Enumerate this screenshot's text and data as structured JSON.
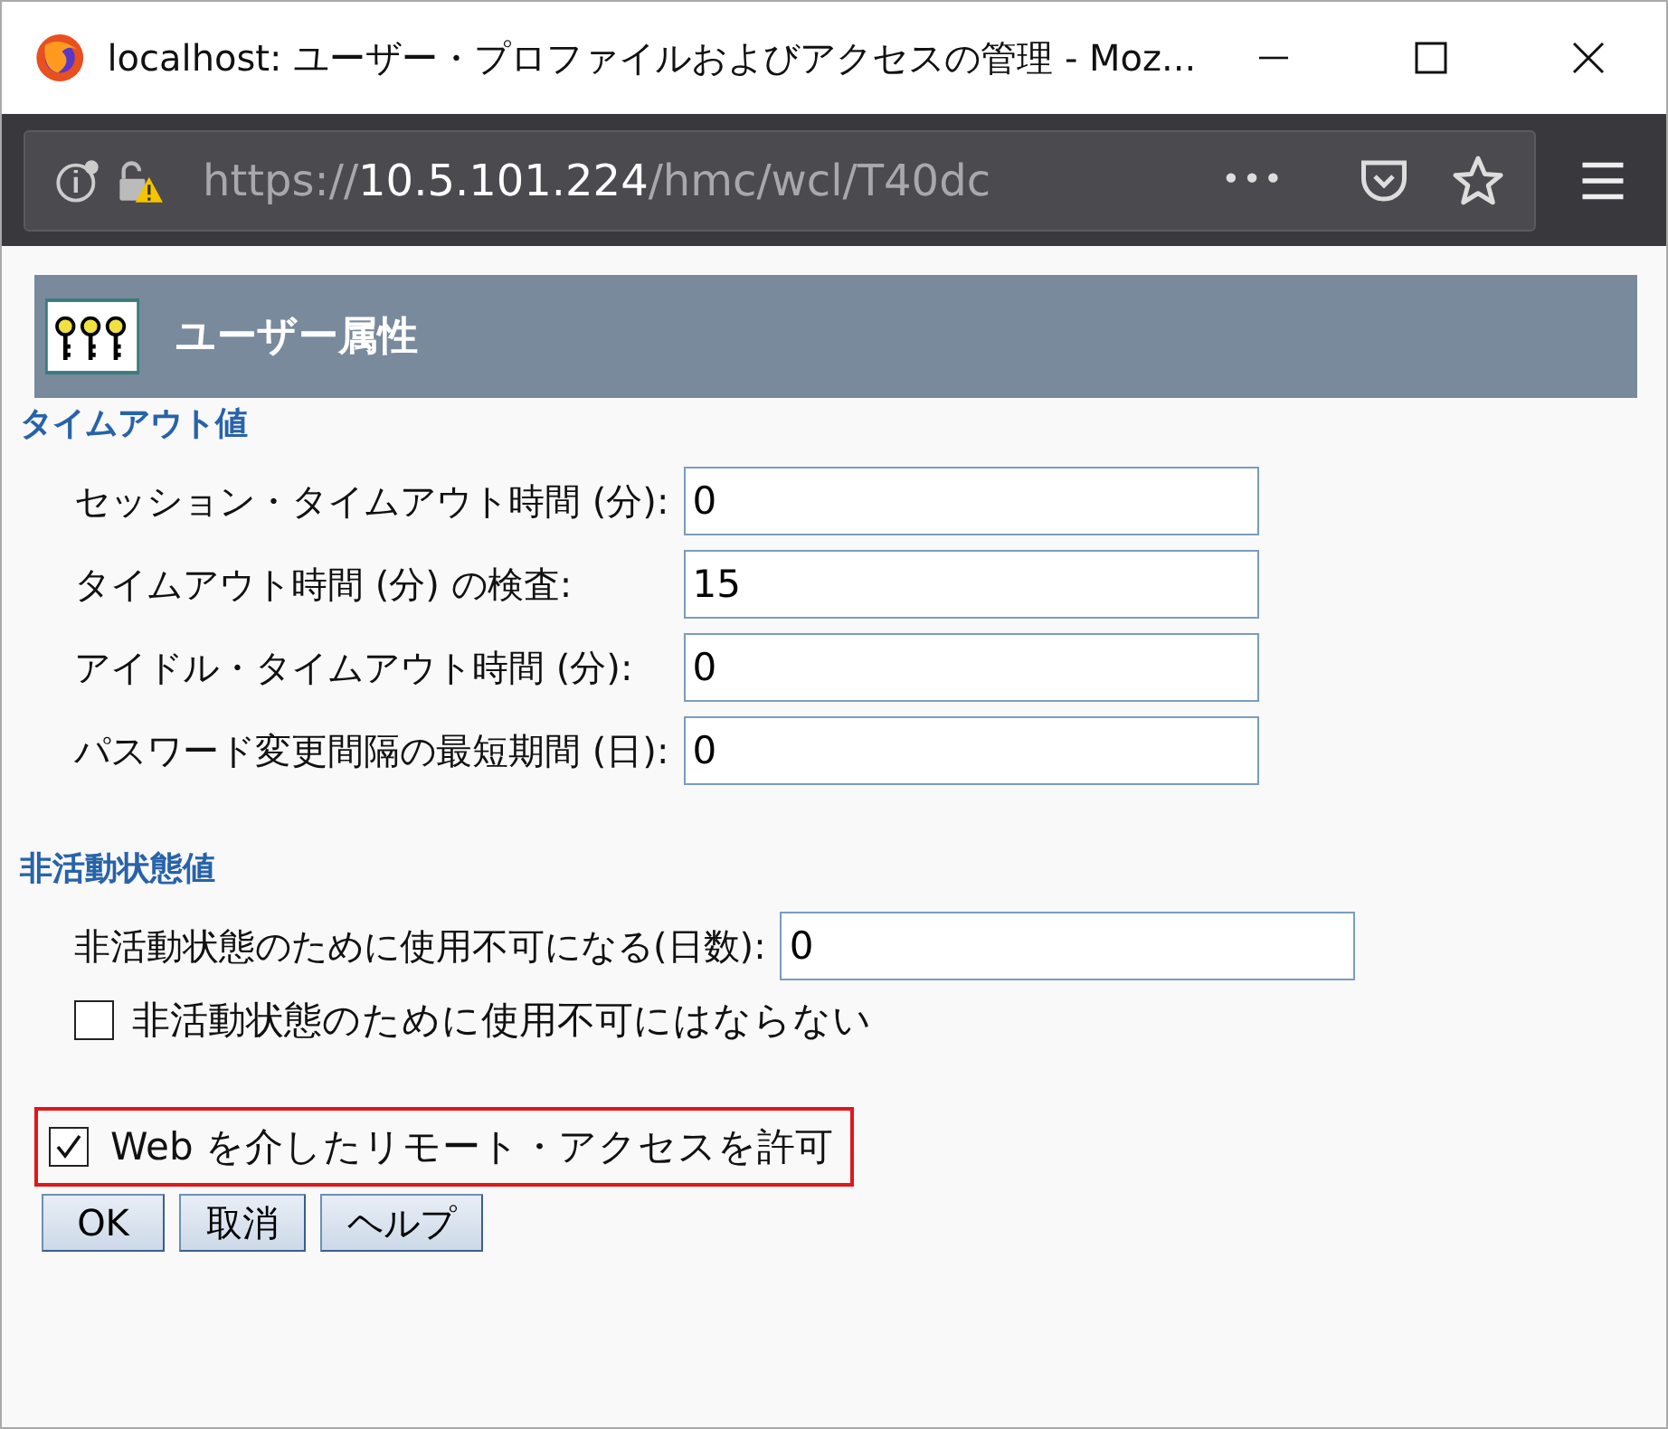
{
  "window": {
    "title": "localhost: ユーザー・プロファイルおよびアクセスの管理 - Moz..."
  },
  "url": {
    "scheme": "https://",
    "host": "10.5.101.224",
    "path": "/hmc/wcl/T40dc"
  },
  "toolbar": {
    "more": "•••"
  },
  "header": {
    "title": "ユーザー属性"
  },
  "sections": [
    {
      "heading": "タイムアウト値",
      "fields": [
        {
          "kind": "text",
          "label": "セッション・タイムアウト時間 (分):",
          "value": "0"
        },
        {
          "kind": "text",
          "label": "タイムアウト時間 (分) の検査:",
          "value": "15"
        },
        {
          "kind": "text",
          "label": "アイドル・タイムアウト時間 (分):",
          "value": "0"
        },
        {
          "kind": "text",
          "label": "パスワード変更間隔の最短期間 (日):",
          "value": "0"
        }
      ]
    },
    {
      "heading": "非活動状態値",
      "fields": [
        {
          "kind": "text",
          "label": "非活動状態のために使用不可になる(日数):",
          "value": "0"
        },
        {
          "kind": "checkbox",
          "label": "非活動状態のために使用不可にはならない",
          "checked": false
        }
      ]
    }
  ],
  "remote_access": {
    "label": "Web を介したリモート・アクセスを許可",
    "checked": true,
    "highlighted": true
  },
  "buttons": [
    "OK",
    "取消",
    "ヘルプ"
  ]
}
